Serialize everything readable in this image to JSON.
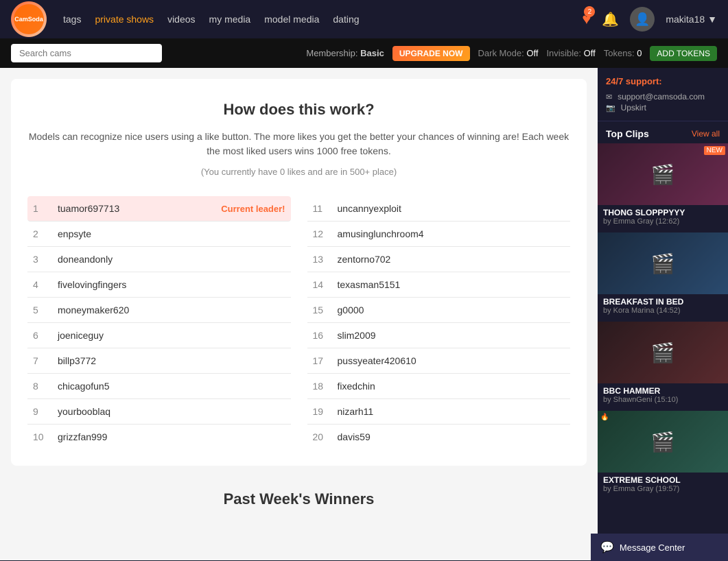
{
  "header": {
    "logo_text": "CamSoda",
    "nav_items": [
      {
        "label": "tags",
        "href": "#"
      },
      {
        "label": "private shows",
        "href": "#",
        "active": true
      },
      {
        "label": "videos",
        "href": "#"
      },
      {
        "label": "my media",
        "href": "#"
      },
      {
        "label": "model media",
        "href": "#"
      },
      {
        "label": "dating",
        "href": "#"
      }
    ],
    "heart_count": "2",
    "username": "makita18"
  },
  "search": {
    "placeholder": "Search cams"
  },
  "membership": {
    "label": "Membership:",
    "level": "Basic",
    "upgrade_label": "UPGRADE NOW",
    "dark_mode_label": "Dark Mode:",
    "dark_mode_value": "Off",
    "invisible_label": "Invisible:",
    "invisible_value": "Off",
    "tokens_label": "Tokens:",
    "tokens_value": "0",
    "add_tokens_label": "ADD TOKENS"
  },
  "panel": {
    "title": "How does this work?",
    "description": "Models can recognize nice users using a like button. The more likes you get the better your chances of winning are! Each week the most liked users wins 1000 free tokens.",
    "note": "(You currently have 0 likes and are in 500+ place)",
    "leaderboard_left": [
      {
        "rank": "1",
        "name": "tuamor697713",
        "leader": true,
        "leader_tag": "Current leader!"
      },
      {
        "rank": "2",
        "name": "enpsyte"
      },
      {
        "rank": "3",
        "name": "doneandonly"
      },
      {
        "rank": "4",
        "name": "fivelovingfingers"
      },
      {
        "rank": "5",
        "name": "moneymaker620"
      },
      {
        "rank": "6",
        "name": "joeniceguy"
      },
      {
        "rank": "7",
        "name": "billp3772"
      },
      {
        "rank": "8",
        "name": "chicagofun5"
      },
      {
        "rank": "9",
        "name": "yourbooblaq"
      },
      {
        "rank": "10",
        "name": "grizzfan999"
      }
    ],
    "leaderboard_right": [
      {
        "rank": "11",
        "name": "uncannyexploit"
      },
      {
        "rank": "12",
        "name": "amusinglunchroom4"
      },
      {
        "rank": "13",
        "name": "zentorno702"
      },
      {
        "rank": "14",
        "name": "texasman5151"
      },
      {
        "rank": "15",
        "name": "g0000"
      },
      {
        "rank": "16",
        "name": "slim2009"
      },
      {
        "rank": "17",
        "name": "pussyeater420610"
      },
      {
        "rank": "18",
        "name": "fixedchin"
      },
      {
        "rank": "19",
        "name": "nizarh11"
      },
      {
        "rank": "20",
        "name": "davis59"
      }
    ]
  },
  "past_winners": {
    "title": "Past Week's Winners"
  },
  "sidebar": {
    "support_title": "24/7 support:",
    "support_email": "support@camsoda.com",
    "support_link": "Upskirt",
    "top_clips_title": "Top Clips",
    "view_all_label": "View all",
    "clips": [
      {
        "title": "THONG SLOPPPYYY",
        "author": "by Emma Gray (12:62)",
        "has_new": true
      },
      {
        "title": "BREAKFAST IN BED",
        "author": "by Kora Marina (14:52)",
        "has_search": true
      },
      {
        "title": "BBC HAMMER",
        "author": "by ShawnGeni (15:10)"
      },
      {
        "title": "EXTREME SCHOOL",
        "author": "by Emma Gray (19:57)",
        "has_fire": true
      }
    ]
  },
  "message_center": {
    "label": "Message Center"
  }
}
